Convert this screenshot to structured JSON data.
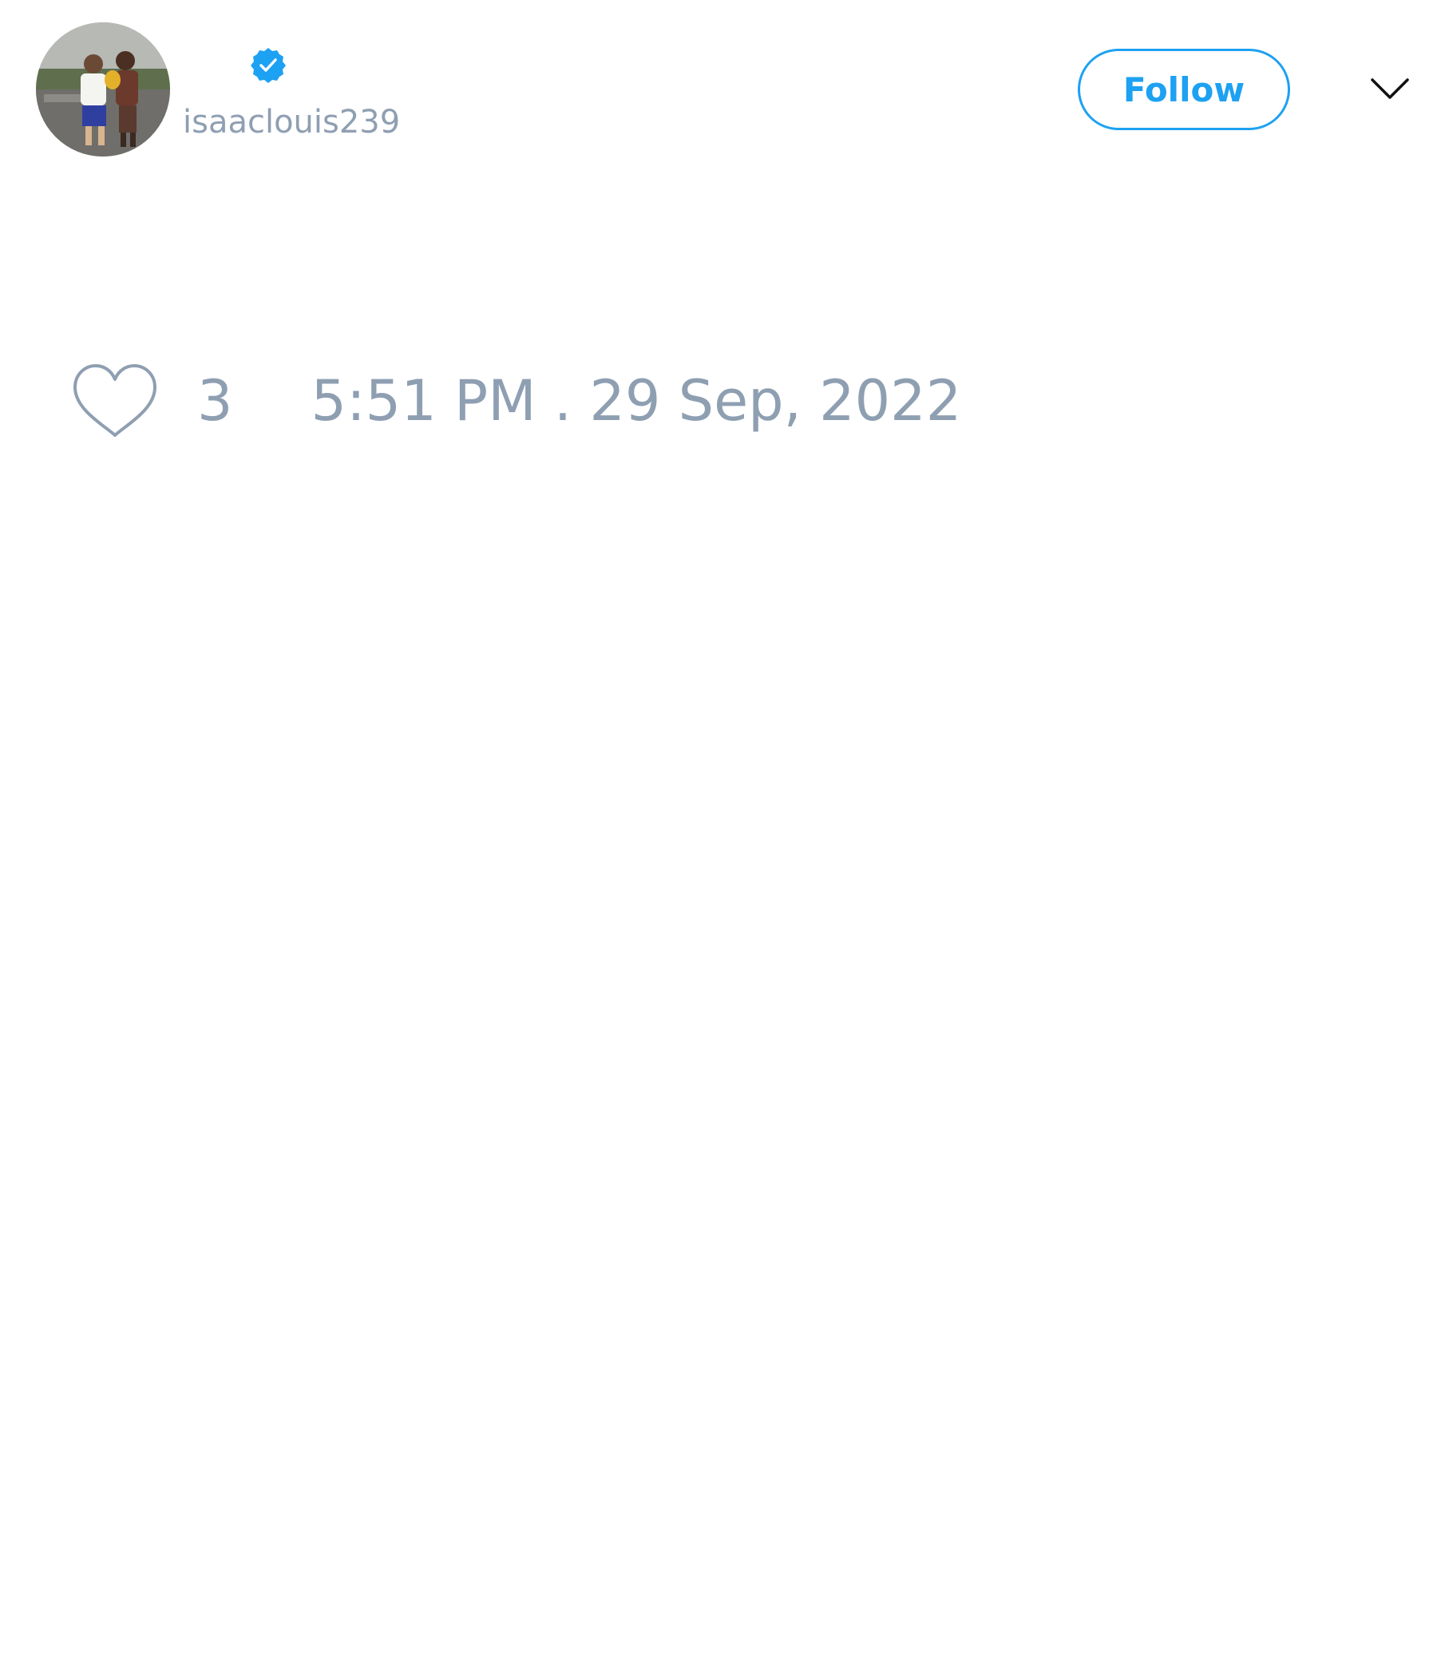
{
  "colors": {
    "accent": "#1da1f2",
    "muted_text": "#8f9fb2",
    "background": "#ffffff"
  },
  "header": {
    "avatar_icon": "user-avatar-photo",
    "verified_icon": "verified-badge-icon",
    "handle": "isaaclouis239",
    "follow_label": "Follow",
    "menu_icon": "chevron-down-icon"
  },
  "footer": {
    "like_icon": "heart-outline-icon",
    "like_count": "3",
    "timestamp": "5:51 PM . 29 Sep, 2022"
  }
}
